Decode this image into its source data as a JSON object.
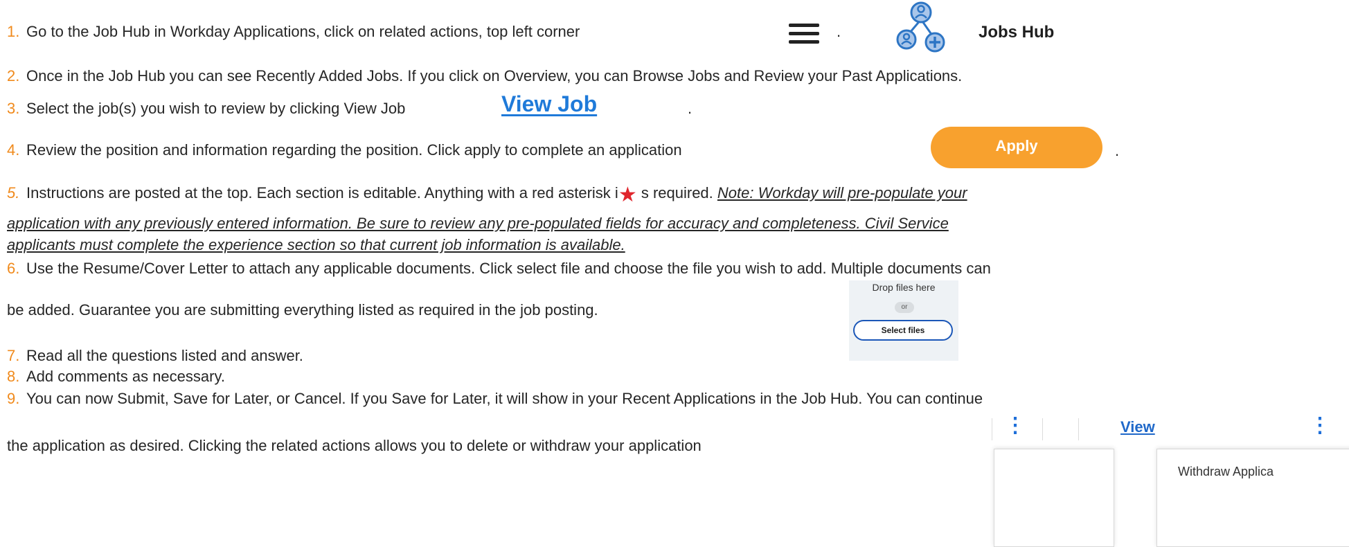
{
  "steps": [
    {
      "num": "1.",
      "text": "Go to the Job Hub in Workday Applications, click on related actions, top left corner",
      "dot": "."
    },
    {
      "num": "2.",
      "text": "Once in the Job Hub you can see Recently Added Jobs.  If you click on Overview, you can Browse Jobs and Review your Past Applications."
    },
    {
      "num": "3.",
      "text": "Select the job(s) you wish to review by clicking View Job",
      "dot": "."
    },
    {
      "num": "4.",
      "text": "Review the position and information regarding the position.  Click apply to complete an application",
      "dot": "."
    },
    {
      "num": "5.",
      "text_before": "Instructions are posted at the top.  Each section is editable.  Anything with a red asterisk  i",
      "text_after": " s required.  ",
      "note_1": "Note:  Workday will pre-populate your",
      "note_2": "application with any previously entered information.  Be sure to review any pre-populated fields for accuracy and completeness.  Civil Service",
      "note_3": "applicants must complete the experience section so that current job information is available."
    },
    {
      "num": "6.",
      "text_1": "Use the Resume/Cover Letter to attach any applicable documents.  Click select file and choose the file you wish to add. Multiple documents can",
      "text_2": "be added.  Guarantee you are submitting everything listed as required in the job posting."
    },
    {
      "num": "7.",
      "text": "Read all the questions listed and answer."
    },
    {
      "num": "8.",
      "text": "Add comments as necessary."
    },
    {
      "num": "9.",
      "text_1": "You can now Submit, Save for Later, or Cancel.  If you Save for Later, it will show in your Recent Applications in the Job Hub.  You can continue",
      "text_2": "the application as desired.  Clicking the related actions allows you to delete or withdraw your application"
    }
  ],
  "jobs_hub": {
    "label": "Jobs Hub",
    "icon": "people-network-plus-icon"
  },
  "view_job": {
    "label": "View Job"
  },
  "apply": {
    "label": "Apply"
  },
  "asterisk": "★",
  "drop_files": {
    "text": "Drop files here",
    "or": "or",
    "button": "Select files"
  },
  "related_actions": {
    "kebab": "⋮",
    "view_fragment": "View",
    "withdraw_fragment": "Withdraw Applica"
  },
  "colors": {
    "number": "#f08a1c",
    "link": "#1f7ad9",
    "apply": "#f8a12e",
    "asterisk": "#e0262d",
    "icon": "#2d75c4"
  }
}
